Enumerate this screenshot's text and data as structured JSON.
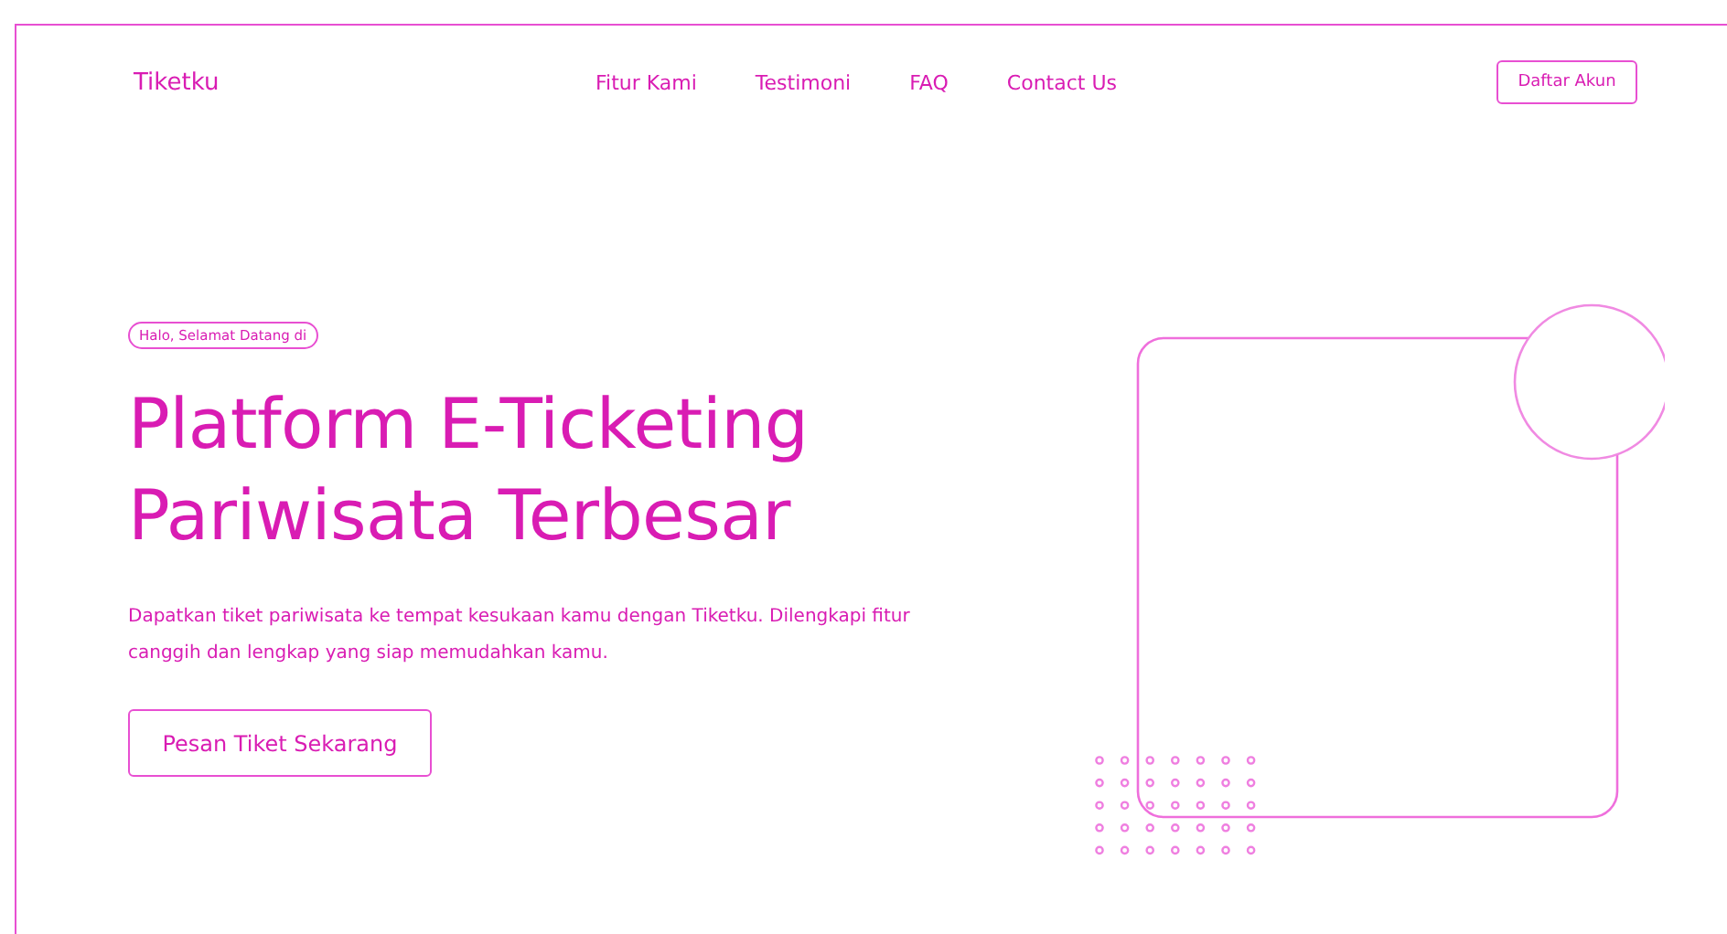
{
  "brand": "Tiketku",
  "nav": [
    "Fitur Kami",
    "Testimoni",
    "FAQ",
    "Contact Us"
  ],
  "signup_button": "Daftar Akun",
  "hero": {
    "badge": "Halo, Selamat Datang di",
    "title_lines": [
      "Platform E-Ticketing",
      "Pariwisata Terbesar"
    ],
    "description": "Dapatkan tiket pariwisata ke tempat kesukaan kamu dengan Tiketku. Dilengkapi fitur canggih dan lengkap yang siap memudahkan kamu.",
    "cta": "Pesan Tiket Sekarang"
  }
}
